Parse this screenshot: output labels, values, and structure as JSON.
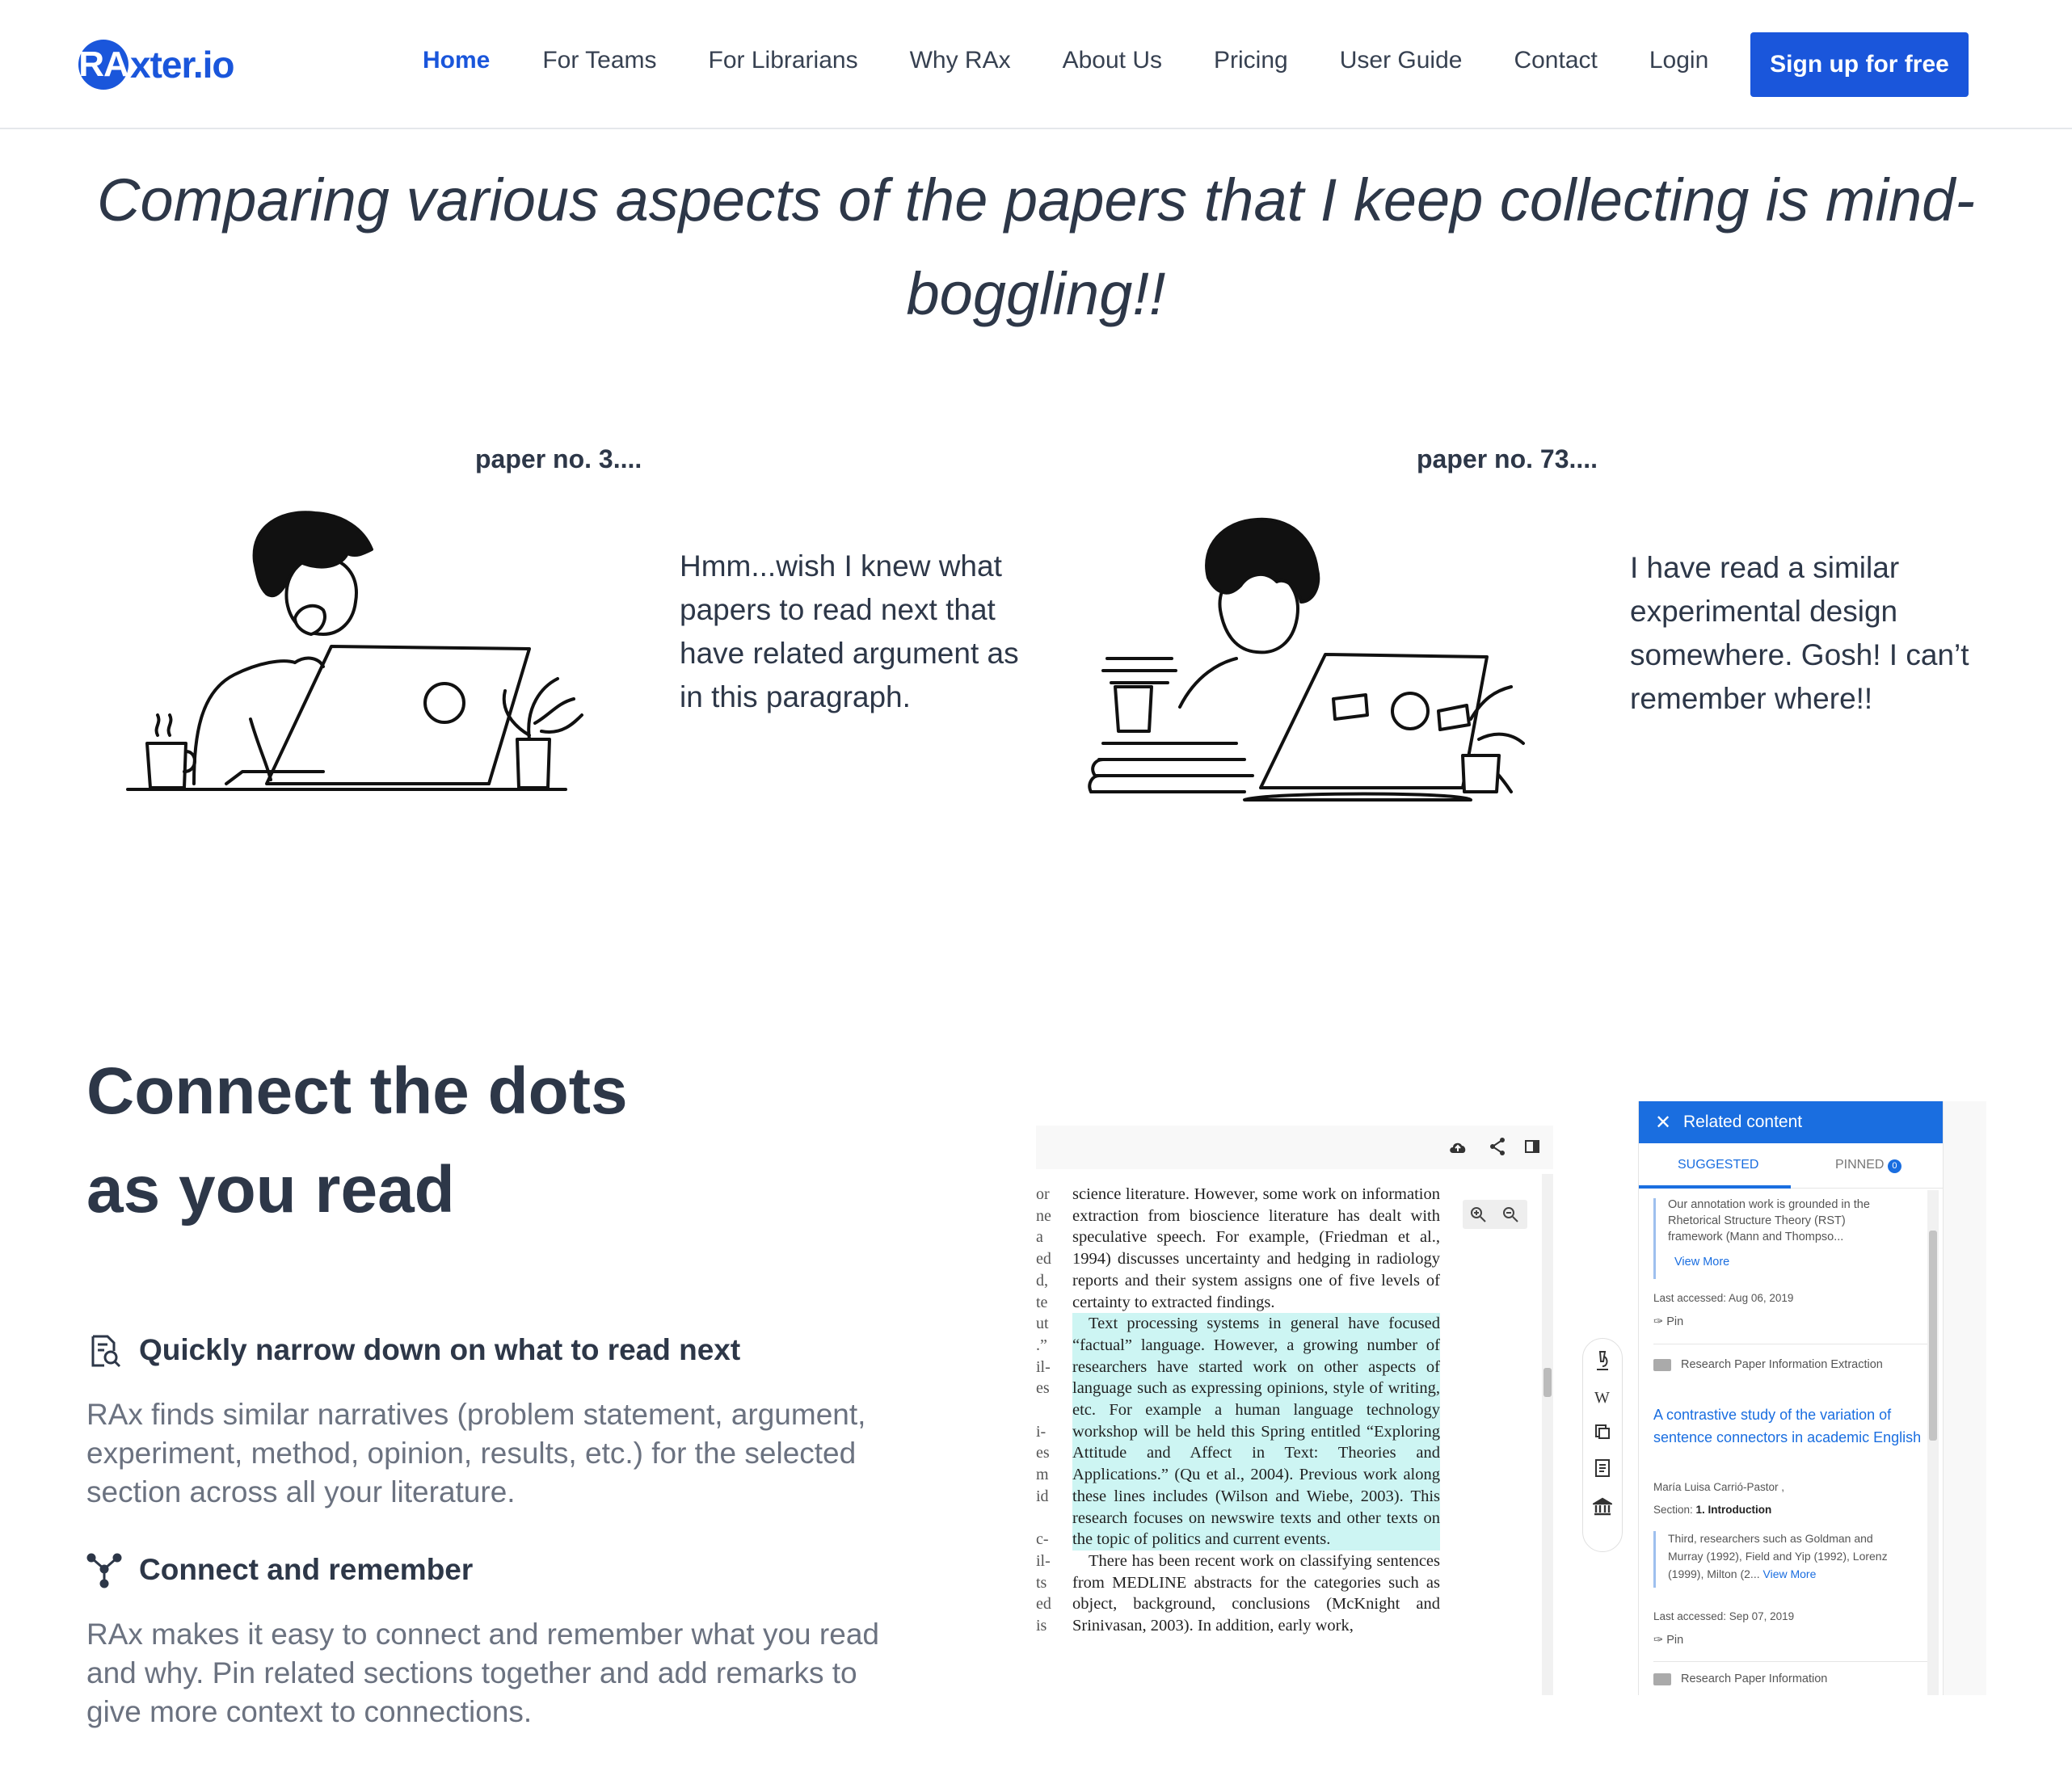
{
  "nav": {
    "logo_ra": "RA",
    "logo_rest": "xter.io",
    "links": [
      "Home",
      "For Teams",
      "For Librarians",
      "Why RAx",
      "About Us",
      "Pricing",
      "User Guide",
      "Contact",
      "Login"
    ],
    "signup": "Sign up for free"
  },
  "headline": "Comparing various aspects of the papers that I keep collecting is mind-boggling!!",
  "panel_left": {
    "title": "paper no. 3....",
    "quote": "Hmm...wish I knew what papers to read next that have related argument as in this paragraph."
  },
  "panel_right": {
    "title": "paper no. 73....",
    "quote": "I have read a similar experimental design somewhere. Gosh! I can’t remember where!!"
  },
  "section": {
    "heading_line1": "Connect the dots",
    "heading_line2": "as you read",
    "feature1_title": "Quickly narrow down on what to read next",
    "feature1_desc": "RAx finds similar narratives (problem statement, argument, experiment, method, opinion, results, etc.) for the selected section across all your literature.",
    "feature2_title": "Connect and remember",
    "feature2_desc": "RAx makes it easy to connect and remember what you read and why. Pin related sections together and add remarks to give more context to connections."
  },
  "screenshot": {
    "doc_para1": "science literature. However, some work on information extraction from bioscience literature has dealt with speculative speech. For example, (Friedman et al., 1994) discusses uncertainty and hedging in radiology reports and their system assigns one of five levels of certainty to extracted findings.",
    "doc_para2": "Text processing systems in general have focused “factual” language. However, a growing number of researchers have started work on other aspects of language such as expressing opinions, style of writing, etc. For example a human language technology workshop will be held this Spring entitled “Exploring Attitude and Affect in Text: Theories and Applications.” (Qu et al., 2004). Previous work along these lines includes (Wilson and Wiebe, 2003). This research focuses on newswire texts and other texts on the topic of politics and current events.",
    "doc_para3": "There has been recent work on classifying sentences from MEDLINE abstracts for the categories such as object, background, conclusions (McKnight and Srinivasan, 2003). In addition, early work,",
    "margin": [
      "or",
      "ne",
      "a",
      "ed",
      "d,",
      "te",
      "ut",
      ".”",
      "il-",
      "es",
      "",
      "i-",
      "es",
      "m",
      "id",
      "",
      "c-",
      "il-",
      "ts",
      "ed",
      "is"
    ],
    "panel_title": "Related content",
    "tab_suggested": "SUGGESTED",
    "tab_pinned": "PINNED",
    "pinned_count": "0",
    "snippet1": "Our annotation work is grounded in the Rhetorical Structure Theory (RST) framework (Mann and Thompso...",
    "view_more": "View More",
    "last_accessed1": "Last accessed: Aug 06, 2019",
    "pin": "Pin",
    "folder1": "Research Paper Information Extraction",
    "paper_title": "A contrastive study of the variation of sentence connectors in academic English",
    "author": "María Luisa Carrió-Pastor ,",
    "section_label": "Section:",
    "section_value": "1. Introduction",
    "snippet2": "Third, researchers such as Goldman and Murray (1992), Field and Yip (1992), Lorenz (1999), Milton (2...",
    "view_more2": "View More",
    "last_accessed2": "Last accessed: Sep 07, 2019",
    "pin2": "Pin",
    "folder2": "Research Paper Information"
  },
  "colors": {
    "brand": "#1a56db",
    "text": "#2d3748",
    "muted": "#6b7280",
    "panel_blue": "#1a6ee0",
    "highlight": "#cdf5f3"
  }
}
